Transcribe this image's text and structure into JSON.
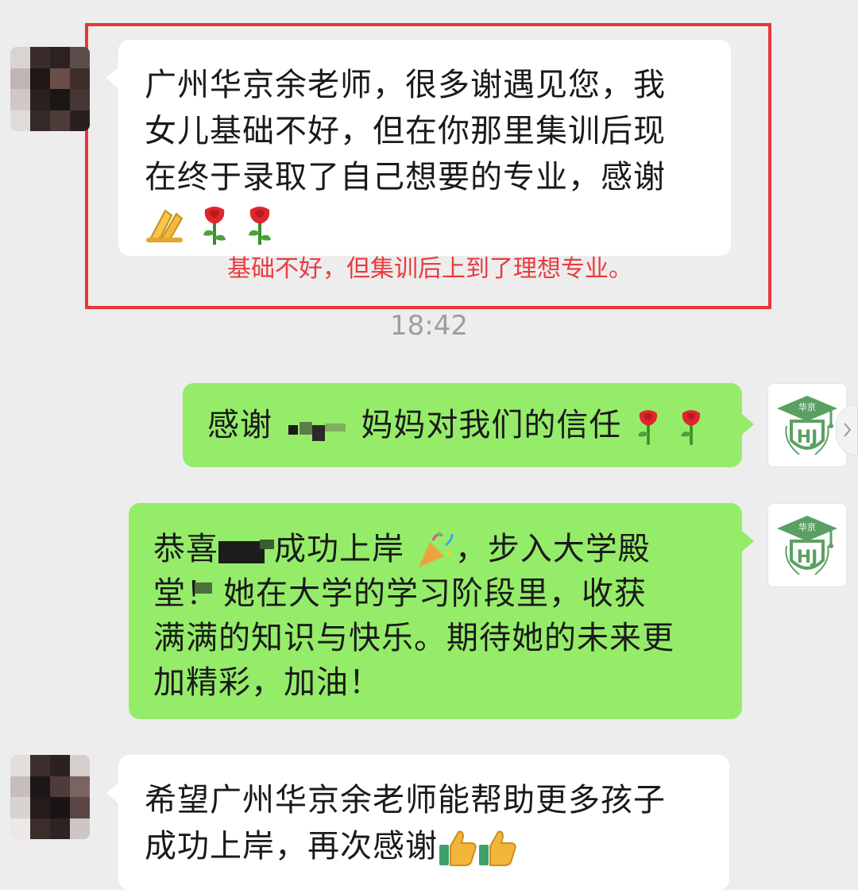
{
  "chat": {
    "time": "18:42",
    "annotation": "基础不好，但集训后上到了理想专业。",
    "messages": [
      {
        "sender": "parent",
        "lines": [
          "广州华京余老师，很多谢遇见您，我",
          "女儿基础不好，但在你那里集训后现",
          "在终于录取了自己想要的专业，感谢"
        ],
        "emoji": [
          "folded-hands-emoji",
          "rose-emoji",
          "rose-emoji"
        ]
      },
      {
        "sender": "school",
        "prefix": "感谢",
        "suffix": "妈妈对我们的信任",
        "emoji": [
          "rose-emoji",
          "rose-emoji"
        ]
      },
      {
        "sender": "school",
        "line1_prefix": "恭喜",
        "line1_mid": "成功上岸",
        "line1_suffix": "，步入大学殿",
        "line2_first": "堂！",
        "line2_rest": "她在大学的学习阶段里，收获",
        "line3": "满满的知识与快乐。期待她的未来更",
        "line4": "加精彩，加油！"
      },
      {
        "sender": "parent",
        "lines": [
          "希望广州华京余老师能帮助更多孩子",
          "成功上岸，再次感谢"
        ],
        "emoji": [
          "thumbs-up-emoji",
          "thumbs-up-emoji"
        ]
      }
    ],
    "school_logo_text": "华京",
    "school_logo_monogram": "HJ",
    "colors": {
      "bubble_green": "#95ec69",
      "bubble_white": "#ffffff",
      "annotation_red": "#e8363c",
      "background": "#ededed"
    }
  }
}
